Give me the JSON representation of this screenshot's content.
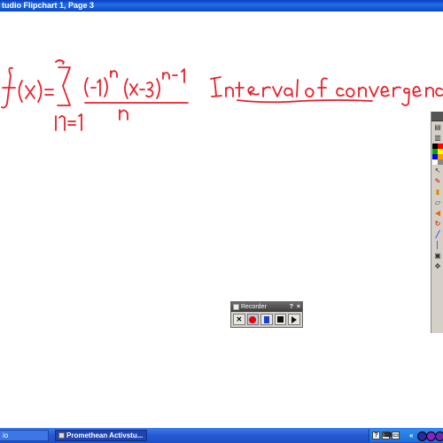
{
  "window": {
    "title": "tudio  Flipchart 1, Page 3"
  },
  "flipchart": {
    "ink_color": "#e8202a",
    "formula_label": "f(x)=",
    "question": "Interval of convergence?"
  },
  "toolbox": {
    "colors": [
      "#000000",
      "#ff0000",
      "#00aa00",
      "#ffff00",
      "#0000ff",
      "#ff9900",
      "#ffffff",
      "#888888"
    ],
    "tools": [
      "pages-icon",
      "flipchart-icon",
      "select-icon",
      "pen-icon",
      "highlighter-icon",
      "eraser-icon",
      "back-icon",
      "forward-icon",
      "line-icon",
      "shape-icon",
      "camera-icon",
      "pointer-icon"
    ]
  },
  "recorder": {
    "title": "Recorder",
    "help_label": "?",
    "close_label": "×"
  },
  "taskbar": {
    "left_item": "io",
    "main_item": "Promethean Activstu...",
    "tray_collapse": "«"
  }
}
